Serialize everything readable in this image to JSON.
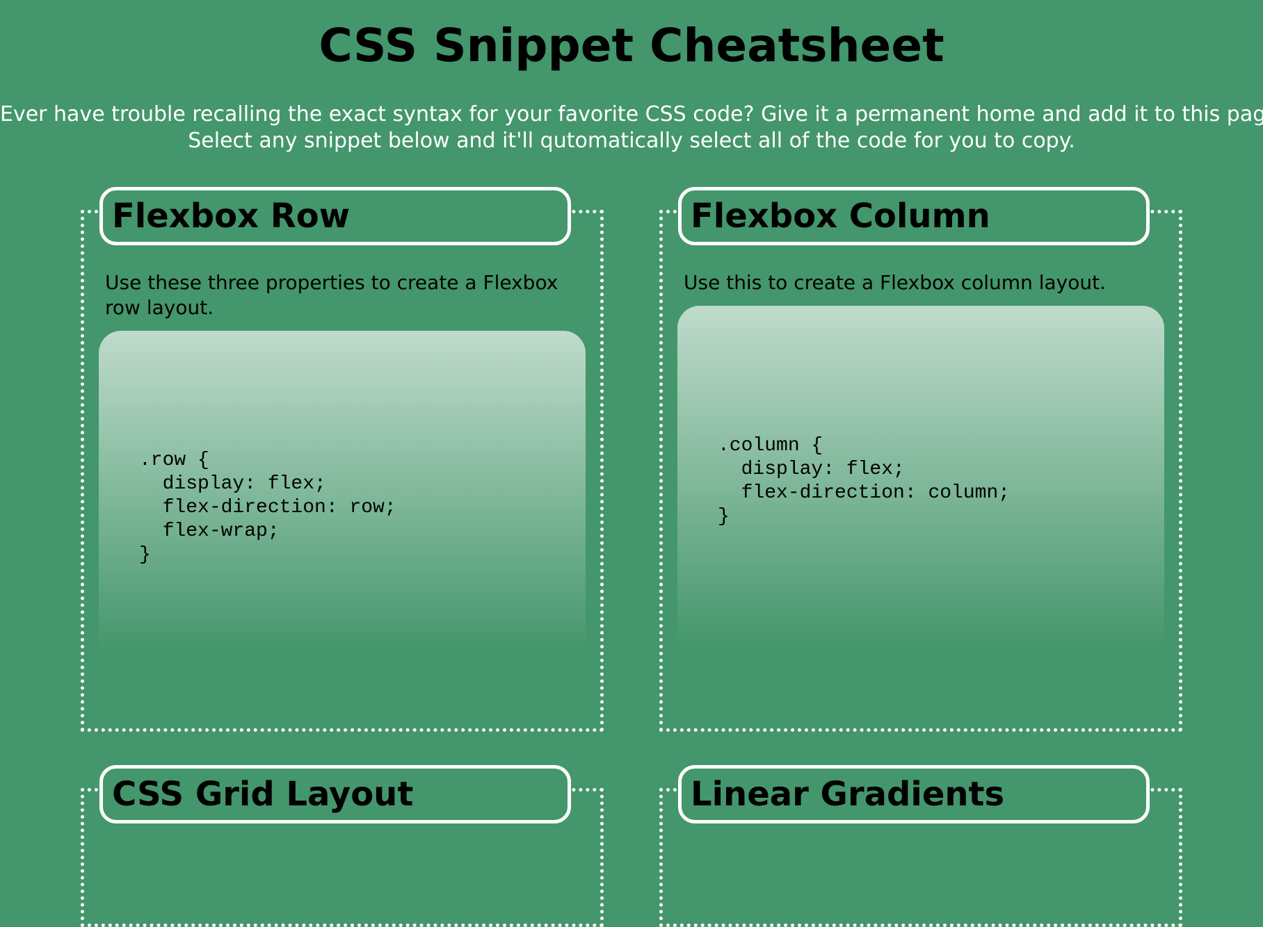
{
  "page": {
    "title": "CSS Snippet Cheatsheet",
    "intro_line1": "Ever have trouble recalling the exact syntax for your favorite CSS code? Give it a permanent home and add it to this page!",
    "intro_line2": "Select any snippet below and it'll qutomatically select all of the code for you to copy."
  },
  "colors": {
    "background": "#44966c",
    "border": "#ffffff",
    "snippet_gradient_top": "#bfdbcb",
    "snippet_gradient_bottom": "#44966c"
  },
  "cards": [
    {
      "title": "Flexbox Row",
      "description": "Use these three properties to create a Flexbox row layout.",
      "code": ".row {\n  display: flex;\n  flex-direction: row;\n  flex-wrap;\n}"
    },
    {
      "title": "Flexbox Column",
      "description": "Use this to create a Flexbox column layout.",
      "code": ".column {\n  display: flex;\n  flex-direction: column;\n}"
    },
    {
      "title": "CSS Grid Layout"
    },
    {
      "title": "Linear Gradients"
    }
  ]
}
